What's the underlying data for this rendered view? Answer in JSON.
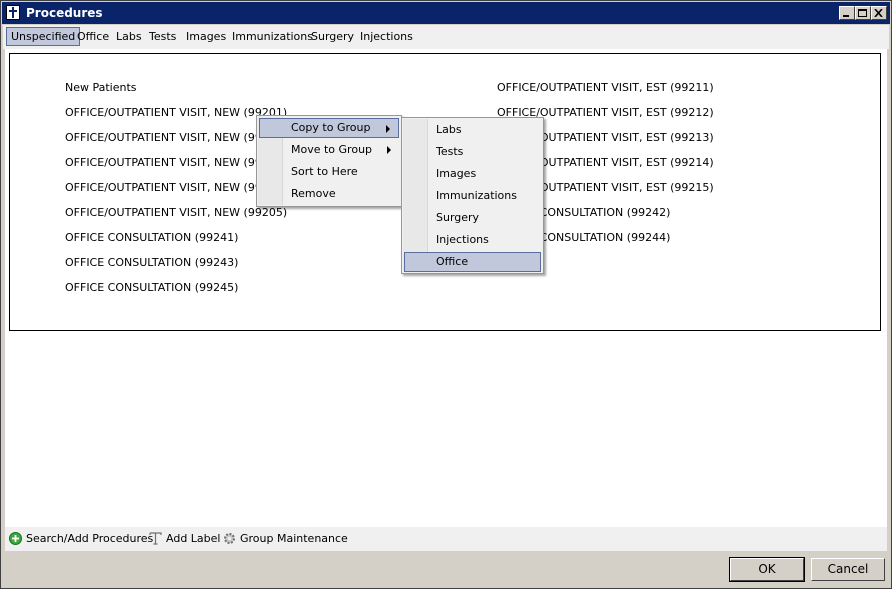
{
  "window": {
    "title": "Procedures"
  },
  "tabs": [
    "Unspecified",
    "Office",
    "Labs",
    "Tests",
    "Images",
    "Immunizations",
    "Surgery",
    "Injections"
  ],
  "active_tab": "Unspecified",
  "left_column": [
    "New Patients",
    "OFFICE/OUTPATIENT VISIT, NEW (99201)",
    "OFFICE/OUTPATIENT VISIT, NEW (99",
    "OFFICE/OUTPATIENT VISIT, NEW (99",
    "OFFICE/OUTPATIENT VISIT, NEW (99",
    "OFFICE/OUTPATIENT VISIT, NEW (99205)",
    "OFFICE CONSULTATION (99241)",
    "OFFICE CONSULTATION (99243)",
    "OFFICE CONSULTATION (99245)"
  ],
  "right_column": [
    "OFFICE/OUTPATIENT VISIT, EST (99211)",
    "OFFICE/OUTPATIENT VISIT, EST (99212)",
    "OFFICE/OUTPATIENT VISIT, EST (99213)",
    "OFFICE/OUTPATIENT VISIT, EST (99214)",
    "OFFICE/OUTPATIENT VISIT, EST (99215)",
    "OFFICE CONSULTATION (99242)",
    "OFFICE CONSULTATION (99244)"
  ],
  "context_menu": {
    "items": [
      "Copy to Group",
      "Move to Group",
      "Sort to Here",
      "Remove"
    ],
    "highlighted": "Copy to Group"
  },
  "submenu": {
    "items": [
      "Labs",
      "Tests",
      "Images",
      "Immunizations",
      "Surgery",
      "Injections",
      "Office"
    ],
    "highlighted": "Office"
  },
  "footer": {
    "search_add": "Search/Add Procedures",
    "add_label": "Add Label",
    "group_maintenance": "Group Maintenance"
  },
  "buttons": {
    "ok": "OK",
    "cancel": "Cancel"
  },
  "colors": {
    "titlebar": "#0a246a",
    "highlight": "#c1c8dc",
    "highlight_border": "#5a6e9c"
  }
}
